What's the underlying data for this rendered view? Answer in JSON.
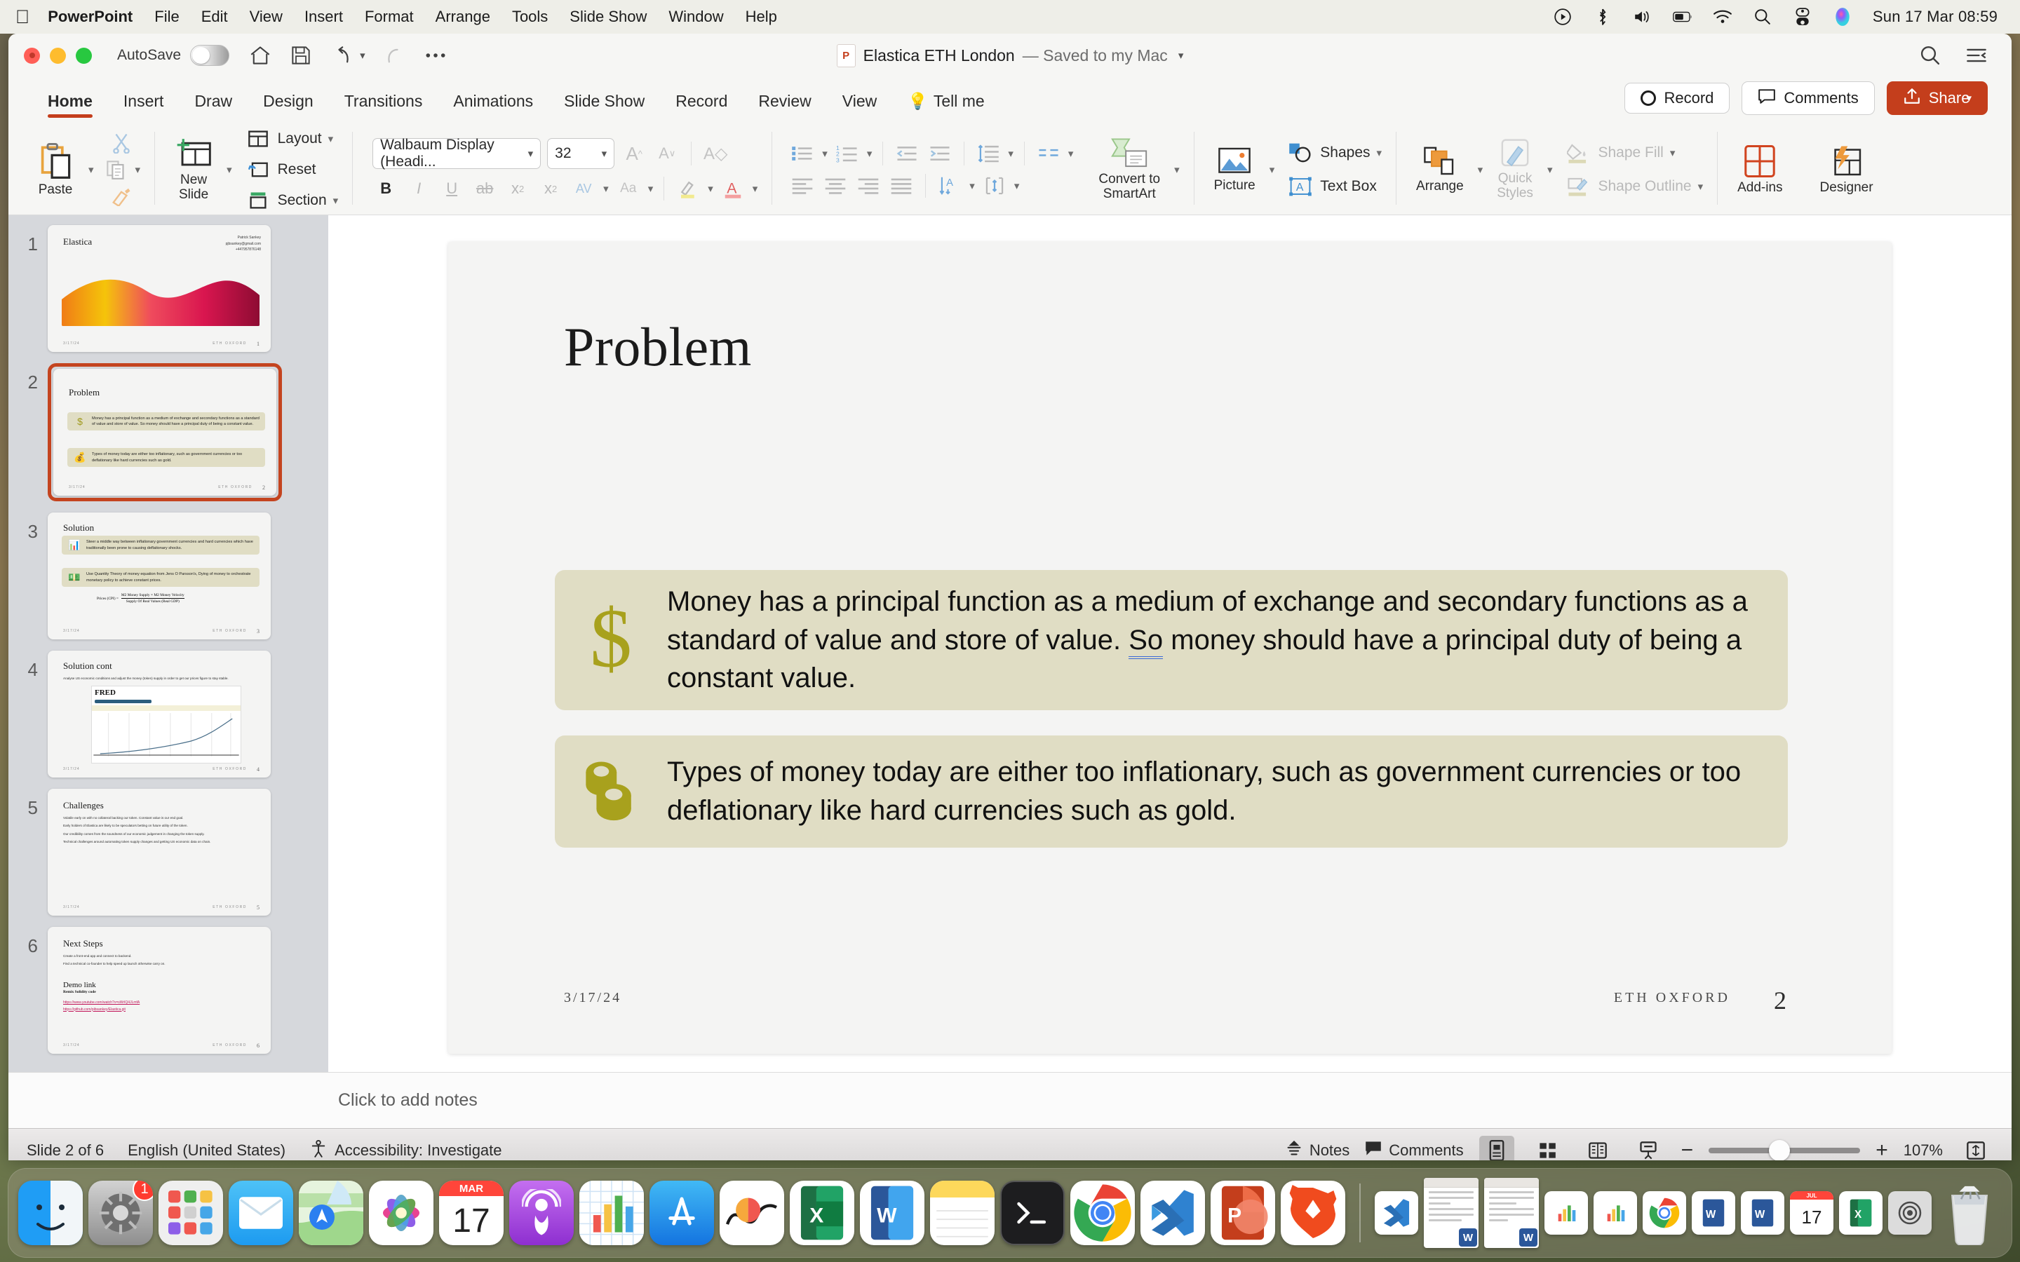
{
  "menubar": {
    "apple": "apple-logo",
    "items": [
      "PowerPoint",
      "File",
      "Edit",
      "View",
      "Insert",
      "Format",
      "Arrange",
      "Tools",
      "Slide Show",
      "Window",
      "Help"
    ],
    "status_icons": [
      "control-center-play-icon",
      "bluetooth-icon",
      "volume-icon",
      "battery-icon",
      "wifi-icon",
      "spotlight-search-icon",
      "control-center-icon",
      "siri-icon"
    ],
    "clock": "Sun 17 Mar  08:59"
  },
  "titlebar": {
    "autosave_label": "AutoSave",
    "autosave_state": "off",
    "quick_icons": [
      "home-icon",
      "save-icon",
      "undo-icon",
      "redo-icon",
      "more-options-icon"
    ],
    "doc_icon": "powerpoint-file-icon",
    "doc_title": "Elastica ETH London",
    "doc_subtitle": "— Saved to my Mac",
    "right_icons": [
      "search-icon",
      "ribbon-display-icon"
    ]
  },
  "ribbon": {
    "tabs": [
      {
        "label": "Home",
        "active": true
      },
      {
        "label": "Insert",
        "active": false
      },
      {
        "label": "Draw",
        "active": false
      },
      {
        "label": "Design",
        "active": false
      },
      {
        "label": "Transitions",
        "active": false
      },
      {
        "label": "Animations",
        "active": false
      },
      {
        "label": "Slide Show",
        "active": false
      },
      {
        "label": "Record",
        "active": false
      },
      {
        "label": "Review",
        "active": false
      },
      {
        "label": "View",
        "active": false
      },
      {
        "label": "Tell me",
        "active": false
      }
    ],
    "record_label": "Record",
    "comments_label": "Comments",
    "share_label": "Share",
    "groups": {
      "clipboard": {
        "paste": "Paste",
        "cut": "cut-icon",
        "copy": "copy-icon",
        "format_painter": "format-painter-icon"
      },
      "slides": {
        "new_slide": "New Slide",
        "layout": "Layout",
        "reset": "Reset",
        "section": "Section"
      },
      "font": {
        "font_name": "Walbaum Display (Headi...",
        "font_size": "32",
        "grow": "grow-font-icon",
        "shrink": "shrink-font-icon",
        "clear_format": "clear-formatting-icon",
        "bold": "B",
        "italic": "I",
        "underline": "U",
        "strikethrough": "strikethrough-icon",
        "superscript": "superscript-icon",
        "subscript": "subscript-icon",
        "char_spacing": "AV",
        "change_case": "Aa",
        "highlight": "text-highlight-icon",
        "font_color": "font-color-icon"
      },
      "paragraph": {
        "bullets": "bullets-icon",
        "numbering": "numbering-icon",
        "decrease_indent": "decrease-indent-icon",
        "increase_indent": "increase-indent-icon",
        "line_spacing": "line-spacing-icon",
        "columns": "columns-icon",
        "convert_smartart": "Convert to SmartArt",
        "align_left": "align-left-icon",
        "align_center": "align-center-icon",
        "align_right": "align-right-icon",
        "justify": "justify-icon",
        "text_direction": "text-direction-icon",
        "align_text": "align-text-icon"
      },
      "insert": {
        "picture": "Picture",
        "shapes": "Shapes",
        "text_box": "Text Box"
      },
      "drawing": {
        "arrange": "Arrange",
        "quick_styles": "Quick Styles",
        "shape_fill": "Shape Fill",
        "shape_outline": "Shape Outline"
      },
      "addins": {
        "add_ins": "Add-ins",
        "designer": "Designer"
      }
    }
  },
  "thumbnails": [
    {
      "number": "1",
      "selected": false,
      "title": "Elastica",
      "kind": "title",
      "contact": [
        "Patrick Sankey",
        "pjbsankey@gmail.com",
        "+447957876148"
      ],
      "foot_date": "3/17/24",
      "foot_org": "ETH OXFORD",
      "foot_num": "1"
    },
    {
      "number": "2",
      "selected": true,
      "title": "Problem",
      "kind": "two-boxes",
      "boxes": [
        {
          "icon": "$",
          "text": "Money has a principal function as a medium of exchange and secondary functions as a standard of value and store of value. So money should have a principal duty of being a constant value."
        },
        {
          "icon": "coins",
          "text": "Types of money today are either too inflationary, such as government currencies or too deflationary like hard currencies such as gold."
        }
      ],
      "foot_date": "3/17/24",
      "foot_org": "ETH OXFORD",
      "foot_num": "2"
    },
    {
      "number": "3",
      "selected": false,
      "title": "Solution",
      "kind": "two-boxes-formula",
      "boxes": [
        {
          "icon": "chart",
          "text": "Steer a middle way between inflationary government currencies and hard currencies which have traditionally been prone to causing deflationary shocks."
        },
        {
          "icon": "money",
          "text": "Use Quantity Theory of money equation from Jens O Parsson's, Dying of money to orchestrate monetary policy to achieve constant prices."
        }
      ],
      "formula": {
        "lhs": "Prices (CPI) =",
        "num": "M2 Money Supply × M2 Money Velocity",
        "den": "Supply Of Real Values (Real GDP)"
      },
      "foot_date": "3/17/24",
      "foot_org": "ETH OXFORD",
      "foot_num": "3"
    },
    {
      "number": "4",
      "selected": false,
      "title": "Solution cont",
      "kind": "chart",
      "bullets": [
        "Analyse US economic conditions and adjust the money (token) supply in order to get our prices figure to stay stable."
      ],
      "image_label": "FRED",
      "foot_date": "3/17/24",
      "foot_org": "ETH OXFORD",
      "foot_num": "4"
    },
    {
      "number": "5",
      "selected": false,
      "title": "Challenges",
      "kind": "bullets",
      "bullets": [
        "Volatile early on with no collateral backing our token. Constant value is our end goal.",
        "Early holders of Elastica are likely to be speculators betting on future utility of the token.",
        "Our credibility comes from the soundness of our economic judgement in changing the token supply.",
        "Technical challenges around automating token supply changes and getting US economic data on chain."
      ],
      "foot_date": "3/17/24",
      "foot_org": "ETH OXFORD",
      "foot_num": "5"
    },
    {
      "number": "6",
      "selected": false,
      "title": "Next Steps",
      "kind": "bullets-links",
      "bullets": [
        "Create a front-end app and connect to backend.",
        "Find a technical co-founder to help speed up launch otherwise carry on."
      ],
      "subtitle": "Demo link",
      "subsubtitle": "Remix Solidity code",
      "links": [
        "https://www.youtube.com/watch?v=sWrIQ4JLmfA",
        "https://github.com/pibsankey/Elastica.git"
      ],
      "foot_date": "3/17/24",
      "foot_org": "ETH OXFORD",
      "foot_num": "6"
    }
  ],
  "slide": {
    "title": "Problem",
    "boxes": [
      {
        "icon": "dollar-sign-icon",
        "text_part1": "Money has a principal function as a medium of exchange and secondary functions as a standard of value and store of value. ",
        "text_flagged": "So",
        "text_part2": " money should have a principal duty of being a constant value."
      },
      {
        "icon": "coins-icon",
        "text_part1": "Types of money today are either too inflationary, such as government currencies or too deflationary like hard currencies such as gold.",
        "text_flagged": "",
        "text_part2": ""
      }
    ],
    "footer_date": "3/17/24",
    "footer_org": "ETH OXFORD",
    "footer_number": "2"
  },
  "notes": {
    "placeholder": "Click to add notes"
  },
  "statusbar": {
    "slide_count": "Slide 2 of 6",
    "language": "English (United States)",
    "accessibility": "Accessibility: Investigate",
    "notes_label": "Notes",
    "comments_label": "Comments",
    "views": [
      "normal-view-icon",
      "slide-sorter-icon",
      "reading-view-icon",
      "presenter-view-icon"
    ],
    "zoom_out": "−",
    "zoom_in": "+",
    "zoom_value": "107%",
    "fit_slide": "fit-to-window-icon"
  },
  "dock": {
    "apps": [
      {
        "name": "finder-icon",
        "badge": ""
      },
      {
        "name": "system-settings-icon",
        "badge": "1"
      },
      {
        "name": "launchpad-icon",
        "badge": ""
      },
      {
        "name": "mail-icon",
        "badge": ""
      },
      {
        "name": "maps-icon",
        "badge": ""
      },
      {
        "name": "photos-icon",
        "badge": ""
      },
      {
        "name": "calendar-icon",
        "badge": ""
      },
      {
        "name": "podcasts-icon",
        "badge": ""
      },
      {
        "name": "numbers-icon",
        "badge": ""
      },
      {
        "name": "app-store-icon",
        "badge": ""
      },
      {
        "name": "keynote-icon",
        "badge": ""
      },
      {
        "name": "excel-icon",
        "badge": ""
      },
      {
        "name": "word-icon",
        "badge": ""
      },
      {
        "name": "notes-icon",
        "badge": ""
      },
      {
        "name": "terminal-icon",
        "badge": ""
      },
      {
        "name": "chrome-icon",
        "badge": ""
      },
      {
        "name": "vscode-icon",
        "badge": ""
      },
      {
        "name": "powerpoint-icon",
        "badge": ""
      },
      {
        "name": "brave-icon",
        "badge": ""
      }
    ],
    "calendar_month": "MAR",
    "calendar_day": "17",
    "recents": [
      {
        "name": "vscode-recent-icon"
      },
      {
        "name": "word-window-minimized"
      },
      {
        "name": "word-window-minimized"
      }
    ],
    "minimized": [
      {
        "name": "numbers-minimized-icon"
      },
      {
        "name": "numbers-minimized-icon"
      },
      {
        "name": "chrome-minimized-icon"
      },
      {
        "name": "word-minimized-icon"
      },
      {
        "name": "word-minimized-icon"
      },
      {
        "name": "calendar-minimized-icon"
      },
      {
        "name": "excel-minimized-icon"
      },
      {
        "name": "preview-minimized-icon"
      }
    ],
    "trash": "trash-icon"
  },
  "colors": {
    "accent": "#c43e1c",
    "box_fill": "#e0ddc4",
    "icon_gold": "#a8a11d",
    "grammar_underline": "#3b6ad6"
  }
}
